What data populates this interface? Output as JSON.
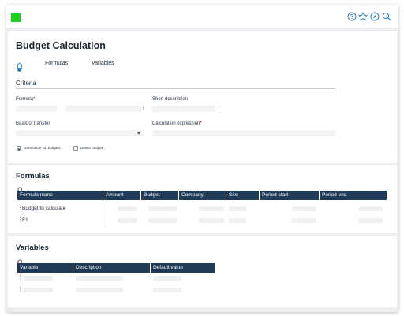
{
  "page": {
    "title": "Budget Calculation",
    "tabs": [
      "Formulas",
      "Variables"
    ]
  },
  "topbar": {
    "icons": [
      "help-icon",
      "star-icon",
      "compass-icon",
      "search-icon"
    ],
    "logo_color": "#1dd21d"
  },
  "criteria": {
    "section_title": "Criteria",
    "formula_label": "Formula",
    "short_description_label": "Short description",
    "basis_of_transfer_label": "Basis of transfer",
    "calculation_expression_label": "Calculation expression",
    "generation_gl_budgets_label": "Generation GL budgets",
    "generation_gl_budgets_checked": true,
    "delete_budget_label": "Delete budget",
    "delete_budget_checked": false
  },
  "formulas": {
    "title": "Formulas",
    "columns": [
      "Formula name",
      "Amount",
      "Budget",
      "Company",
      "Site",
      "Period  start",
      "Period end"
    ],
    "rows": [
      {
        "name": "Budget to calculate"
      },
      {
        "name": "F1"
      }
    ]
  },
  "variables": {
    "title": "Variables",
    "columns": [
      "Variable",
      "Description",
      "Default value"
    ],
    "rows": [
      {},
      {}
    ]
  },
  "colors": {
    "header_bg": "#1f3b57",
    "accent": "#2f7fc1",
    "required": "#d0021b"
  }
}
